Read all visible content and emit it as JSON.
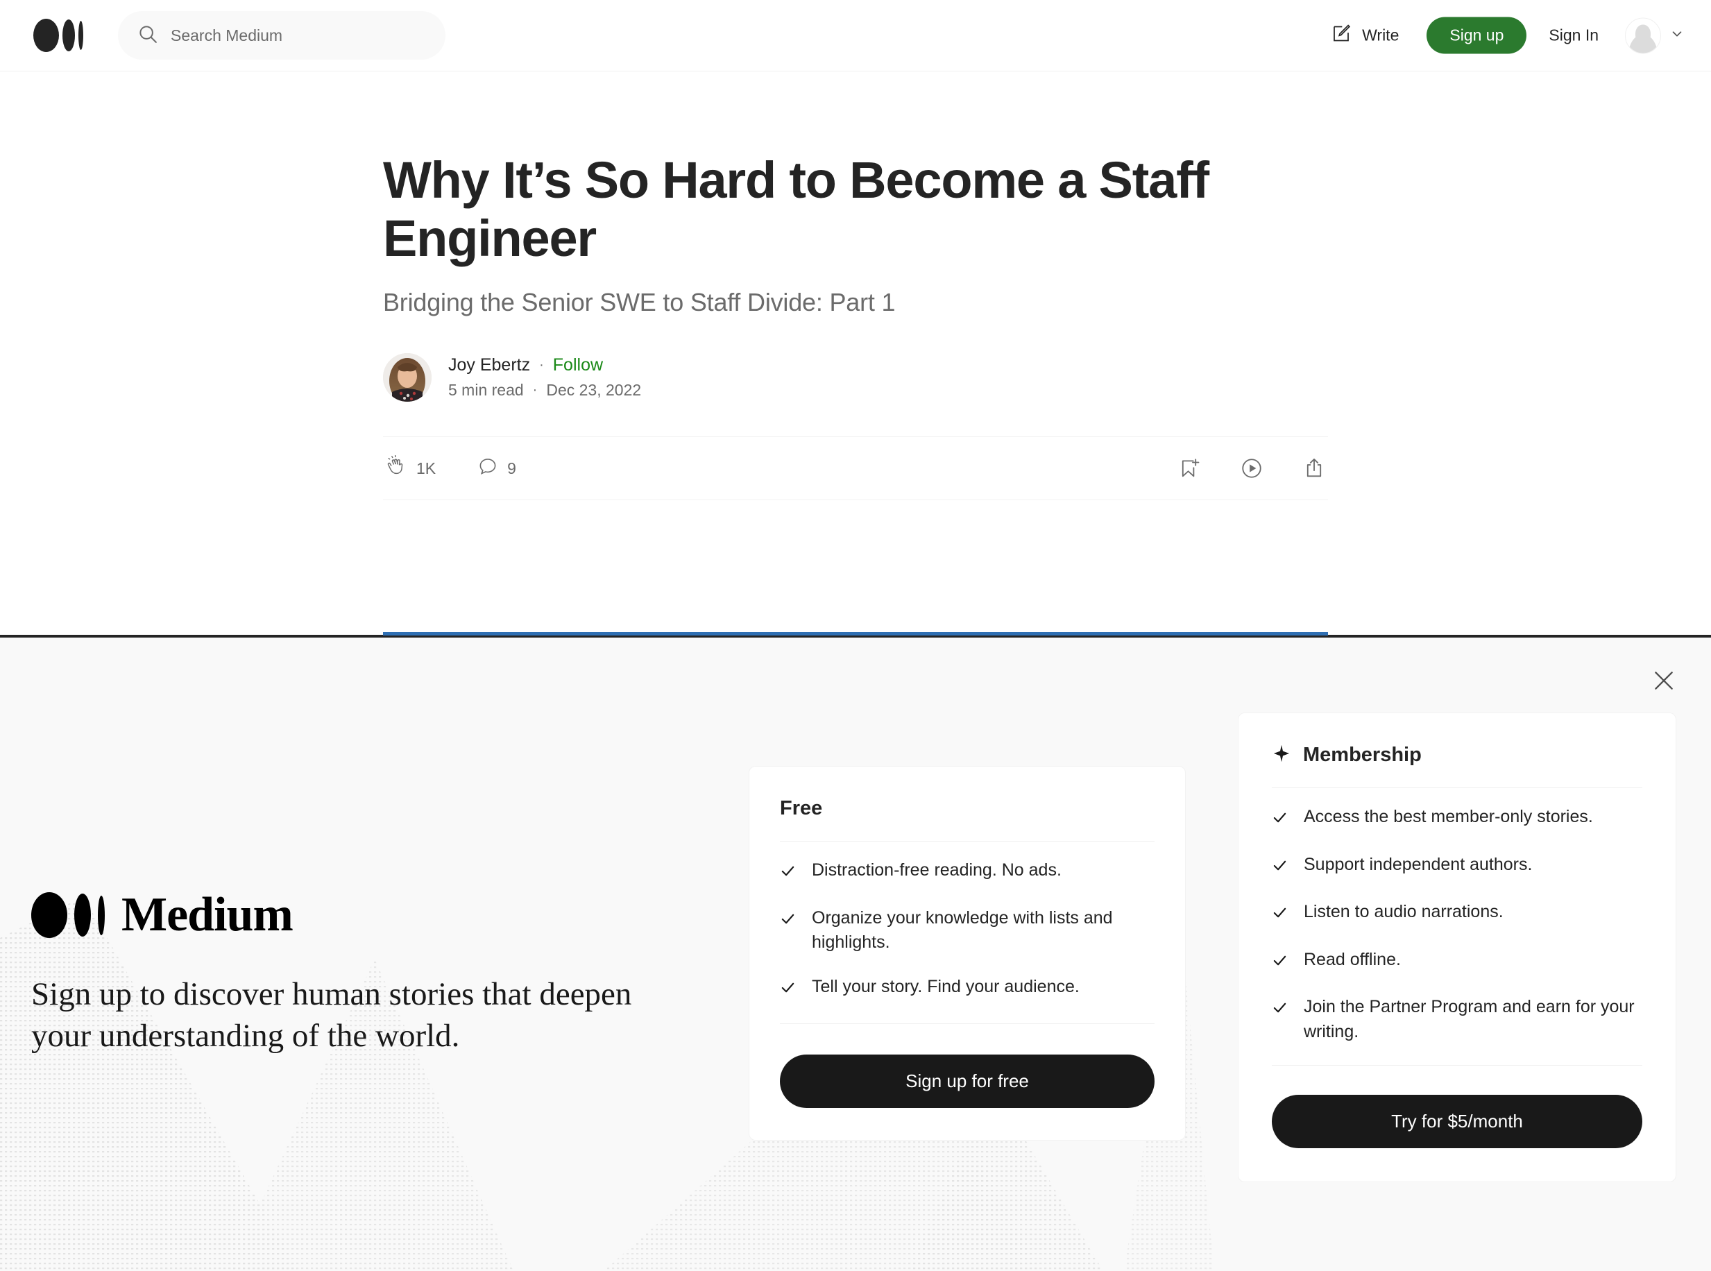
{
  "header": {
    "logo_name": "Medium",
    "search": {
      "placeholder": "Search Medium",
      "value": "",
      "icon": "search-icon"
    },
    "write_label": "Write",
    "write_icon": "write-pencil-icon",
    "signup_label": "Sign up",
    "signin_label": "Sign In",
    "avatar_icon": "default-user-avatar",
    "chevron_icon": "chevron-down-icon",
    "signup_color": "#2b7a2e"
  },
  "article": {
    "title": "Why It’s So Hard to Become a Staff Engineer",
    "subtitle": "Bridging the Senior SWE to Staff Divide: Part 1",
    "author": {
      "name": "Joy Ebertz",
      "avatar_icon": "author-avatar-photo",
      "separator": "·",
      "follow_label": "Follow",
      "follow_color": "#1a8917"
    },
    "read_time": "5 min read",
    "meta_separator": "·",
    "date": "Dec 23, 2022",
    "engagement": {
      "clap_icon": "clap-icon",
      "clap_count": "1K",
      "comment_icon": "comment-bubble-icon",
      "comment_count": "9",
      "bookmark_icon": "bookmark-add-icon",
      "listen_icon": "play-circle-listen-icon",
      "share_icon": "share-icon"
    }
  },
  "paywall": {
    "close_icon": "close-icon",
    "brand_name": "Medium",
    "tagline": "Sign up to discover human stories that deepen your understanding of the world.",
    "cards": [
      {
        "id": "free",
        "title": "Free",
        "icon": null,
        "features": [
          "Distraction-free reading. No ads.",
          "Organize your knowledge with lists and highlights.",
          "Tell your story. Find your audience."
        ],
        "cta": "Sign up for free"
      },
      {
        "id": "membership",
        "title": "Membership",
        "icon": "sparkle-star-icon",
        "features": [
          "Access the best member-only stories.",
          "Support independent authors.",
          "Listen to audio narrations.",
          "Read offline.",
          "Join the Partner Program and earn for your writing."
        ],
        "cta": "Try for $5/month"
      }
    ],
    "background_color": "#f9f9f9",
    "cta_color": "#191919"
  }
}
